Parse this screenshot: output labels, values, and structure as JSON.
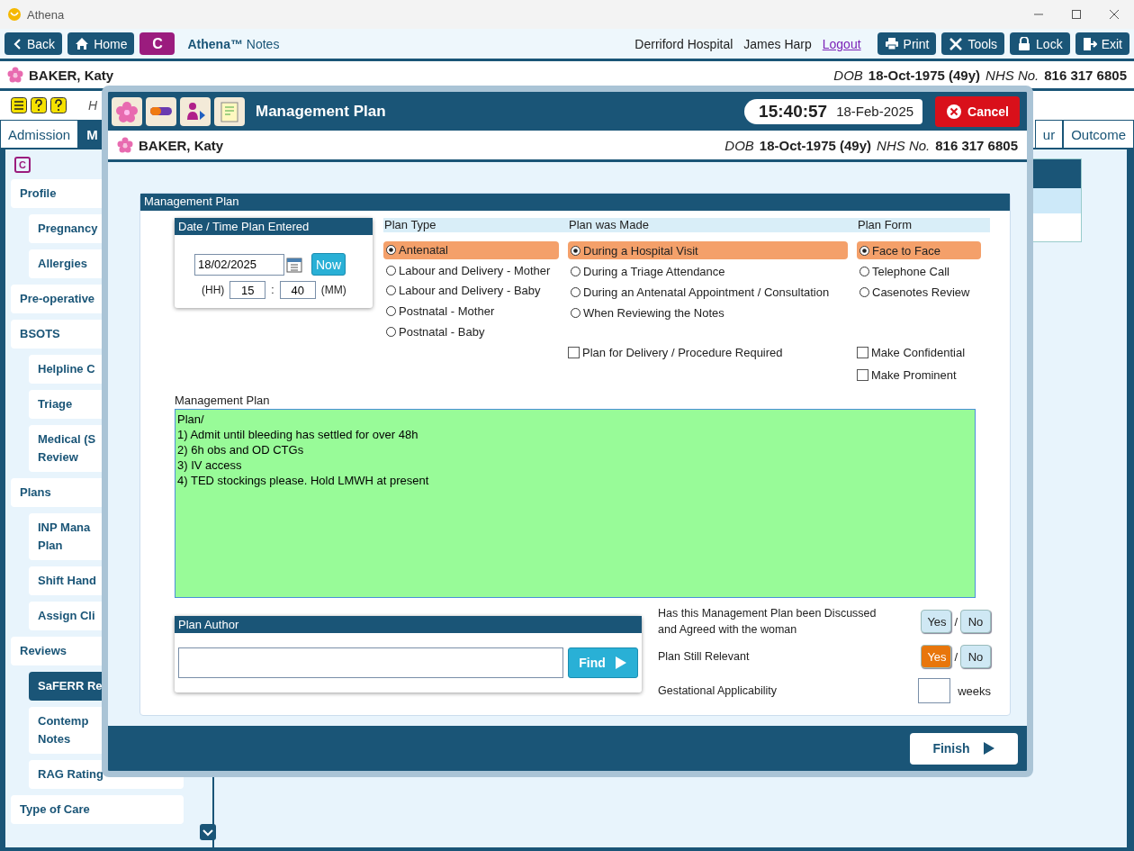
{
  "window": {
    "title": "Athena"
  },
  "toolbar": {
    "left_buttons": [
      {
        "kind": "back",
        "label": "Back"
      },
      {
        "kind": "home",
        "label": "Home"
      }
    ],
    "app_badge": "C",
    "app_name": "**Athena™** Notes",
    "hospital": "Derriford Hospital",
    "user": "James Harp",
    "logout": "Logout",
    "right_buttons": [
      {
        "kind": "print",
        "label": "Print"
      },
      {
        "kind": "tools",
        "label": "Tools"
      },
      {
        "kind": "lock",
        "label": "Lock"
      },
      {
        "kind": "exit",
        "label": "Exit"
      }
    ]
  },
  "patient_banner": {
    "name": "BAKER, Katy",
    "dob_label": "DOB",
    "dob": "18-Oct-1975 (49y)",
    "nhs_label": "NHS No.",
    "nhs": "816 317 6805"
  },
  "help_strip": {
    "text": "H"
  },
  "tabs": [
    {
      "label": "Admission",
      "selected": false
    },
    {
      "label": "M",
      "selected": true
    },
    {
      "label": "ur",
      "selected": false
    },
    {
      "label": "Outcome",
      "selected": false
    }
  ],
  "sidebar": {
    "badge": "C",
    "items": [
      {
        "label": "Profile",
        "selected": false,
        "children": [
          {
            "label": "Pregnancy",
            "selected": false
          },
          {
            "label": "Allergies",
            "selected": false
          }
        ]
      },
      {
        "label": "Pre-operative",
        "selected": false
      },
      {
        "label": "BSOTS",
        "selected": false,
        "children": [
          {
            "label": "Helpline C",
            "selected": false
          },
          {
            "label": "Triage",
            "selected": false
          },
          {
            "label": "Medical (S\nReview",
            "selected": false
          }
        ]
      },
      {
        "label": "Plans",
        "selected": false,
        "children": [
          {
            "label": "INP Mana\nPlan",
            "selected": false
          },
          {
            "label": "Shift Hand",
            "selected": false
          },
          {
            "label": "Assign Cli",
            "selected": false
          }
        ]
      },
      {
        "label": "Reviews",
        "selected": false,
        "children": [
          {
            "label": "SaFERR Re",
            "selected": true
          },
          {
            "label": "Contemp\nNotes",
            "selected": false
          },
          {
            "label": "RAG Rating",
            "selected": false
          }
        ]
      },
      {
        "label": "Type of Care",
        "selected": false
      }
    ]
  },
  "modal": {
    "title": "Management Plan",
    "time": "15:40:57",
    "date": "18-Feb-2025",
    "cancel": "Cancel",
    "patient": {
      "name": "BAKER, Katy",
      "dob_label": "DOB",
      "dob": "18-Oct-1975 (49y)",
      "nhs_label": "NHS No.",
      "nhs": "816 317 6805"
    },
    "section_title": "Management Plan",
    "date_panel": {
      "title": "Date / Time Plan Entered",
      "date": "18/02/2025",
      "now": "Now",
      "hh_label": "(HH)",
      "hh": "15",
      "separator": ":",
      "mm": "40",
      "mm_label": "(MM)"
    },
    "groups": [
      {
        "title": "Plan Type",
        "options": [
          {
            "label": "Antenatal",
            "selected": true
          },
          {
            "label": "Labour and Delivery - Mother",
            "selected": false
          },
          {
            "label": "Labour and Delivery - Baby",
            "selected": false
          },
          {
            "label": "Postnatal - Mother",
            "selected": false
          },
          {
            "label": "Postnatal - Baby",
            "selected": false
          }
        ]
      },
      {
        "title": "Plan was Made",
        "options": [
          {
            "label": "During a Hospital Visit",
            "selected": true
          },
          {
            "label": "During a Triage Attendance",
            "selected": false
          },
          {
            "label": "During an Antenatal Appointment / Consultation",
            "selected": false
          },
          {
            "label": "When Reviewing the Notes",
            "selected": false
          }
        ],
        "checkboxes": [
          {
            "label": "Plan for Delivery / Procedure Required",
            "checked": false
          }
        ]
      },
      {
        "title": "Plan Form",
        "options": [
          {
            "label": "Face to Face",
            "selected": true
          },
          {
            "label": "Telephone Call",
            "selected": false
          },
          {
            "label": "Casenotes Review",
            "selected": false
          }
        ],
        "checkboxes": [
          {
            "label": "Make Confidential",
            "checked": false
          },
          {
            "label": "Make Prominent",
            "checked": false
          }
        ]
      }
    ],
    "notes_label": "Management Plan",
    "notes": [
      "Plan/",
      "1) Admit until bleeding has settled for over 48h",
      "2) 6h obs and OD CTGs",
      "3) IV access",
      "4) TED stockings please. Hold LMWH at present"
    ],
    "author": {
      "title": "Plan Author",
      "find": "Find"
    },
    "questions": [
      {
        "label": "Has this Management Plan been Discussed\nand Agreed with the woman",
        "options": [
          {
            "label": "Yes",
            "selected": false
          },
          {
            "label": "No",
            "selected": false
          }
        ],
        "separator": "/"
      },
      {
        "label": "Plan Still Relevant",
        "options": [
          {
            "label": "Yes",
            "selected": true
          },
          {
            "label": "No",
            "selected": false
          }
        ],
        "separator": "/"
      }
    ],
    "gestation": {
      "label": "Gestational Applicability",
      "unit": "weeks"
    },
    "finish": "Finish"
  }
}
